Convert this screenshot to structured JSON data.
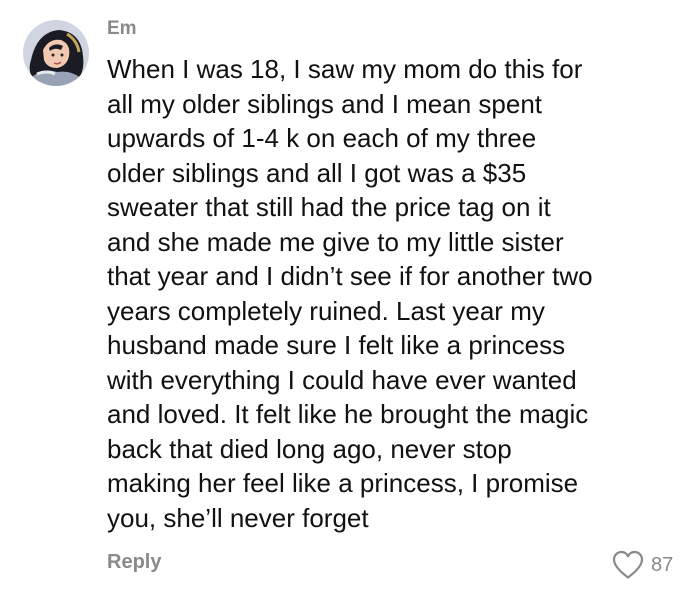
{
  "comment": {
    "author": "Em",
    "avatar_icon": "user-avatar",
    "text": "When I was 18, I saw my mom do this for\nall my older siblings and I mean spent\nupwards of 1-4 k on each of my three\nolder siblings and all I got was a $35\nsweater that still had the price tag on it\nand she made me give to my little sister\nthat year and I didn’t see if for another two\nyears completely ruined. Last year my\nhusband made sure I felt like a princess\nwith everything I could have ever wanted\nand loved. It felt like he brought the magic\nback that died long ago, never stop\nmaking her feel like a princess, I promise\nyou, she’ll never forget",
    "reply_label": "Reply",
    "like_icon": "heart-icon",
    "like_count": "87"
  },
  "colors": {
    "text": "#111111",
    "muted": "#8a8a8a",
    "background": "#ffffff"
  }
}
